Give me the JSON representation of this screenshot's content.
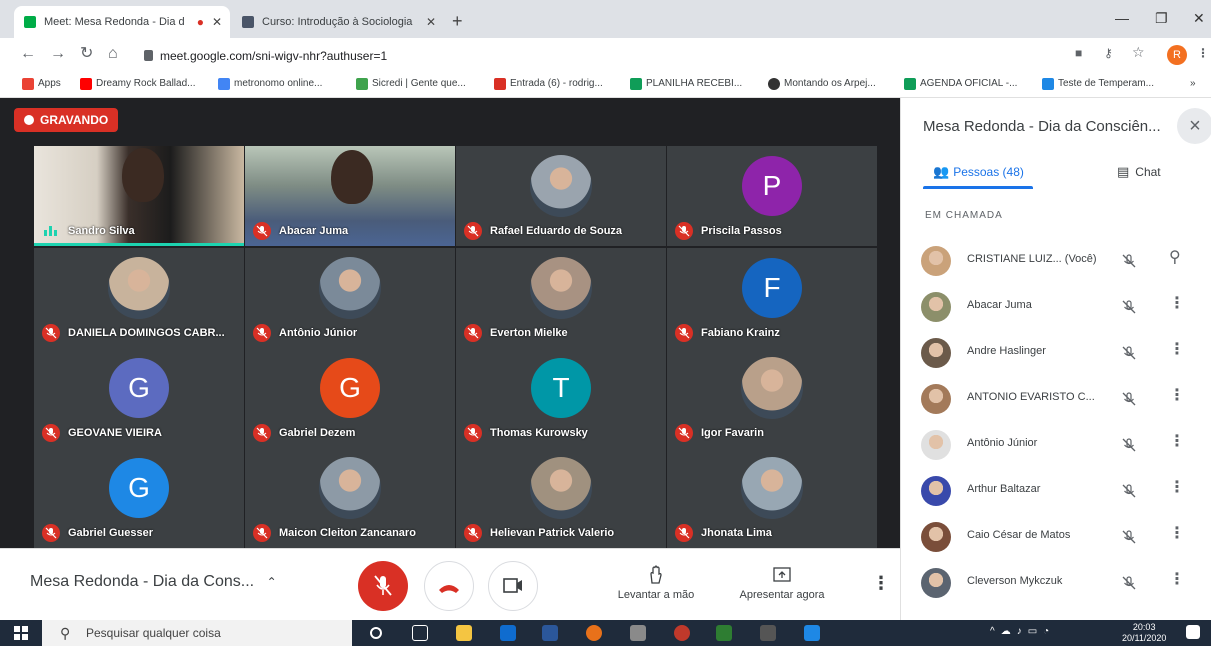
{
  "browser": {
    "tabs": [
      {
        "label": "Meet: Mesa Redonda - Dia d",
        "active": true
      },
      {
        "label": "Curso: Introdução à Sociologia",
        "active": false
      }
    ],
    "url": "meet.google.com/sni-wigv-nhr?authuser=1",
    "profile_initial": "R",
    "bookmarks": [
      "Apps",
      "Dreamy Rock Ballad...",
      "metronomo online...",
      "Sicredi | Gente que...",
      "Entrada (6) - rodrig...",
      "PLANILHA RECEBI...",
      "Montando os Arpej...",
      "AGENDA OFICIAL -...",
      "Teste de Temperam..."
    ]
  },
  "meet": {
    "recording_label": "GRAVANDO",
    "tiles": [
      {
        "name": "Sandro Silva",
        "kind": "video",
        "speaking": true
      },
      {
        "name": "Abacar Juma",
        "kind": "video",
        "speaking": false
      },
      {
        "name": "Rafael Eduardo de Souza",
        "kind": "photo",
        "speaking": false
      },
      {
        "name": "Priscila Passos",
        "kind": "letter",
        "letter": "P",
        "color": "#8e24aa",
        "speaking": false
      },
      {
        "name": "DANIELA DOMINGOS CABR...",
        "kind": "photo",
        "speaking": false
      },
      {
        "name": "Antônio Júnior",
        "kind": "photo",
        "speaking": false
      },
      {
        "name": "Everton Mielke",
        "kind": "photo",
        "speaking": false
      },
      {
        "name": "Fabiano Krainz",
        "kind": "letter",
        "letter": "F",
        "color": "#1565c0",
        "speaking": false
      },
      {
        "name": "GEOVANE VIEIRA",
        "kind": "letter",
        "letter": "G",
        "color": "#5c6bc0",
        "speaking": false
      },
      {
        "name": "Gabriel Dezem",
        "kind": "letter",
        "letter": "G",
        "color": "#e64a19",
        "speaking": false
      },
      {
        "name": "Thomas Kurowsky",
        "kind": "letter",
        "letter": "T",
        "color": "#0097a7",
        "speaking": false
      },
      {
        "name": "Igor Favarin",
        "kind": "photo",
        "speaking": false
      },
      {
        "name": "Gabriel Guesser",
        "kind": "letter",
        "letter": "G",
        "color": "#1e88e5",
        "speaking": false
      },
      {
        "name": "Maicon Cleiton Zancanaro",
        "kind": "photo",
        "speaking": false
      },
      {
        "name": "Helievan Patrick Valerio",
        "kind": "photo",
        "speaking": false
      },
      {
        "name": "Jhonata Lima",
        "kind": "photo",
        "speaking": false
      }
    ],
    "bottom": {
      "meeting_title": "Mesa Redonda - Dia da Cons...",
      "raise_hand_label": "Levantar a mão",
      "present_label": "Apresentar agora"
    }
  },
  "panel": {
    "title": "Mesa Redonda - Dia da Consciên...",
    "tab_people": "Pessoas (48)",
    "tab_chat": "Chat",
    "section_label": "EM CHAMADA",
    "people": [
      {
        "name": "CRISTIANE LUIZ...  (Você)",
        "self": true
      },
      {
        "name": "Abacar Juma",
        "self": false
      },
      {
        "name": "Andre Haslinger",
        "self": false
      },
      {
        "name": "ANTONIO EVARISTO C...",
        "self": false
      },
      {
        "name": "Antônio Júnior",
        "self": false
      },
      {
        "name": "Arthur Baltazar",
        "self": false
      },
      {
        "name": "Caio César de Matos",
        "self": false
      },
      {
        "name": "Cleverson Mykczuk",
        "self": false
      }
    ]
  },
  "taskbar": {
    "search_placeholder": "Pesquisar qualquer coisa",
    "time": "20:03",
    "date": "20/11/2020"
  },
  "colors": {
    "meet_bg": "#202124",
    "mute_red": "#d93025",
    "accent_blue": "#1a73e8"
  }
}
